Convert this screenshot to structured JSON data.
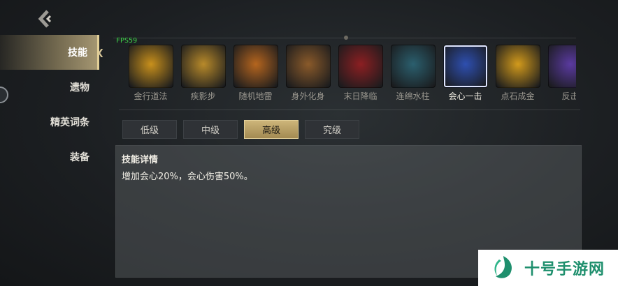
{
  "header": {
    "back_icon": "chevron-left-icon"
  },
  "sidebar": {
    "items": [
      {
        "label": "技能",
        "active": true
      },
      {
        "label": "遗物",
        "active": false
      },
      {
        "label": "精英词条",
        "active": false
      },
      {
        "label": "装备",
        "active": false
      }
    ]
  },
  "overlay": {
    "fps": "FPS59"
  },
  "skills": [
    {
      "name": "金行道法",
      "icon": "golden-ring-icon",
      "color": "#c8901c",
      "active": false
    },
    {
      "name": "疾影步",
      "icon": "golden-boot-icon",
      "color": "#b88a2a",
      "active": false
    },
    {
      "name": "随机地雷",
      "icon": "mine-explosion-icon",
      "color": "#b5651e",
      "active": false
    },
    {
      "name": "身外化身",
      "icon": "shadow-clone-icon",
      "color": "#8a5a2a",
      "active": false
    },
    {
      "name": "末日降临",
      "icon": "doom-red-icon",
      "color": "#8c1f22",
      "active": false
    },
    {
      "name": "连绵水柱",
      "icon": "water-pillar-icon",
      "color": "#2b5f6e",
      "active": false
    },
    {
      "name": "会心一击",
      "icon": "crit-heart-icon",
      "color": "#2e4fb0",
      "active": true
    },
    {
      "name": "点石成金",
      "icon": "midas-gold-icon",
      "color": "#d29a1c",
      "active": false
    },
    {
      "name": "反击",
      "icon": "counter-purple-icon",
      "color": "#5a3aa0",
      "active": false
    }
  ],
  "tiers": [
    {
      "label": "低级",
      "active": false
    },
    {
      "label": "中级",
      "active": false
    },
    {
      "label": "高级",
      "active": true
    },
    {
      "label": "究级",
      "active": false
    }
  ],
  "detail": {
    "title": "技能详情",
    "text": "增加会心20%，会心伤害50%。"
  },
  "watermark": {
    "text": "十号手游网",
    "color": "#1e8f6d"
  }
}
